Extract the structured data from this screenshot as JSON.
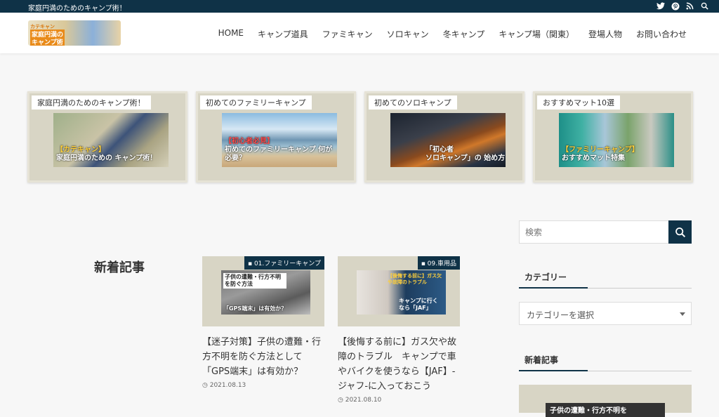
{
  "topbar": {
    "tagline": "家庭円満のためのキャンプ術！",
    "icons": [
      "twitter-icon",
      "pinterest-icon",
      "rss-icon",
      "search-icon"
    ]
  },
  "header": {
    "logo": {
      "top": "カテキャン",
      "mid": "家庭円満の",
      "bottom": "キャンプ術"
    },
    "nav": [
      "HOME",
      "キャンプ道具",
      "ファミキャン",
      "ソロキャン",
      "冬キャンプ",
      "キャンプ場（関東）",
      "登場人物",
      "お問い合わせ"
    ]
  },
  "pickup": [
    {
      "label": "家庭円満のためのキャンプ術！",
      "overlay_hl": "【カテキャン】",
      "overlay": "家庭円満のための キャンプ術！"
    },
    {
      "label": "初めてのファミリーキャンプ",
      "overlay_hl": "【初心者必見】",
      "overlay": "初めてのファミリーキャンプ 何が必要？"
    },
    {
      "label": "初めてのソロキャンプ",
      "overlay_hl": "「初心者",
      "overlay": "ソロキャンプ」の 始め方"
    },
    {
      "label": "おすすめマット10選",
      "overlay_hl": "【ファミリーキャンプ】",
      "overlay": "おすすめマット特集"
    }
  ],
  "latest": {
    "title": "新着記事",
    "posts": [
      {
        "category": "01.ファミリーキャンプ",
        "thumb_text": "子供の遭難・行方不明を防ぐ方法",
        "thumb_text2": "「GPS端末」は有効か？",
        "title": "【迷子対策】子供の遭難・行方不明を防ぐ方法として「GPS端末」は有効か？",
        "date": "2021.08.13"
      },
      {
        "category": "09.車用品",
        "thumb_text": "【後悔する前に】ガス欠や故障のトラブル",
        "thumb_text2": "キャンプに行くなら「JAF」",
        "title": "【後悔する前に】ガス欠や故障のトラブル　キャンプで車やバイクを使うなら【JAF】-ジャフ-に入っておこう",
        "date": "2021.08.10"
      }
    ]
  },
  "sidebar": {
    "search_placeholder": "検索",
    "category_heading": "カテゴリー",
    "category_select": "カテゴリーを選択",
    "latest_heading": "新着記事",
    "latest_thumb_text": "子供の遭難・行方不明を"
  },
  "colors": {
    "navy": "#0f3247",
    "card_bg": "#d8d5c5",
    "accent_orange": "#e98b1a"
  }
}
